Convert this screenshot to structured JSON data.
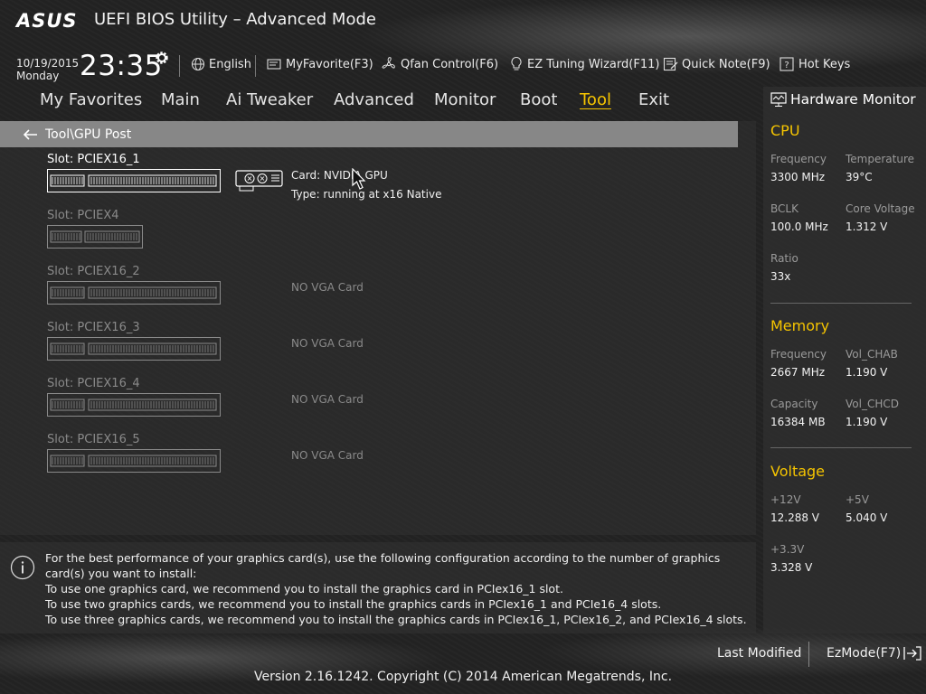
{
  "header": {
    "logo": "ASUS",
    "title": "UEFI BIOS Utility – Advanced Mode"
  },
  "infobar": {
    "date": "10/19/2015",
    "day": "Monday",
    "time": "23:35",
    "items": [
      {
        "label": "English",
        "icon": "globe-icon"
      },
      {
        "label": "MyFavorite(F3)",
        "icon": "favorite-icon"
      },
      {
        "label": "Qfan Control(F6)",
        "icon": "fan-icon"
      },
      {
        "label": "EZ Tuning Wizard(F11)",
        "icon": "lightbulb-icon"
      },
      {
        "label": "Quick Note(F9)",
        "icon": "note-icon"
      },
      {
        "label": "Hot Keys",
        "icon": "question-icon"
      }
    ]
  },
  "nav": {
    "tabs": [
      "My Favorites",
      "Main",
      "Ai Tweaker",
      "Advanced",
      "Monitor",
      "Boot",
      "Tool",
      "Exit"
    ],
    "active": "Tool"
  },
  "breadcrumb": "Tool\\GPU Post",
  "slots": [
    {
      "label": "Slot: PCIEX16_1",
      "status": "occupied",
      "card": "Card: NVIDIA GPU",
      "type": "Type: running at x16 Native"
    },
    {
      "label": "Slot: PCIEX4",
      "status": "empty",
      "info": ""
    },
    {
      "label": "Slot: PCIEX16_2",
      "status": "empty",
      "info": "NO VGA Card"
    },
    {
      "label": "Slot: PCIEX16_3",
      "status": "empty",
      "info": "NO VGA Card"
    },
    {
      "label": "Slot: PCIEX16_4",
      "status": "empty",
      "info": "NO VGA Card"
    },
    {
      "label": "Slot: PCIEX16_5",
      "status": "empty",
      "info": "NO VGA Card"
    }
  ],
  "help": {
    "lines": [
      "For the best performance of your graphics card(s), use the following configuration according to the number of graphics card(s) you want to install:",
      "To use one graphics card, we recommend you to install  the graphics card in PCIex16_1 slot.",
      "To use two graphics cards, we recommend you to install the graphics cards in PCIex16_1 and PCIe16_4 slots.",
      "To use three graphics cards, we recommend you to install the graphics cards in PCIex16_1, PCIex16_2, and PCIex16_4 slots."
    ]
  },
  "hardware_monitor": {
    "title": "Hardware Monitor",
    "cpu": {
      "heading": "CPU",
      "frequency_label": "Frequency",
      "frequency": "3300 MHz",
      "temperature_label": "Temperature",
      "temperature": "39°C",
      "bclk_label": "BCLK",
      "bclk": "100.0 MHz",
      "core_voltage_label": "Core Voltage",
      "core_voltage": "1.312 V",
      "ratio_label": "Ratio",
      "ratio": "33x"
    },
    "memory": {
      "heading": "Memory",
      "frequency_label": "Frequency",
      "frequency": "2667 MHz",
      "vol_chab_label": "Vol_CHAB",
      "vol_chab": "1.190 V",
      "capacity_label": "Capacity",
      "capacity": "16384 MB",
      "vol_chcd_label": "Vol_CHCD",
      "vol_chcd": "1.190 V"
    },
    "voltage": {
      "heading": "Voltage",
      "v12_label": "+12V",
      "v12": "12.288 V",
      "v5_label": "+5V",
      "v5": "5.040 V",
      "v33_label": "+3.3V",
      "v33": "3.328 V"
    }
  },
  "footer": {
    "last_modified": "Last Modified",
    "ezmode": "EzMode(F7)",
    "version": "Version 2.16.1242. Copyright (C) 2014 American Megatrends, Inc."
  },
  "colors": {
    "accent": "#f5c400",
    "breadcrumb_bg": "#878787"
  }
}
